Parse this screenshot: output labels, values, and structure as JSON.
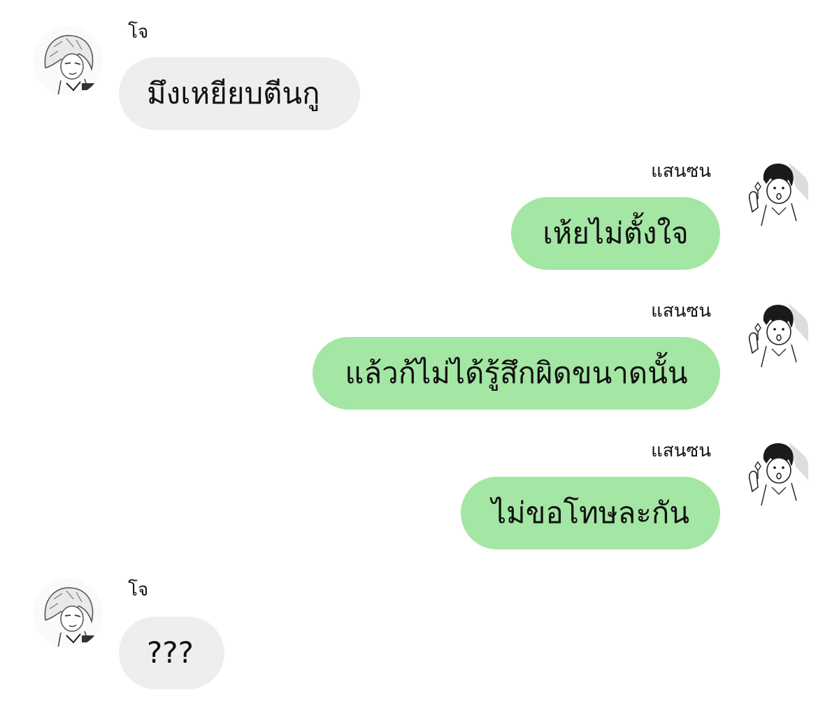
{
  "colors": {
    "background": "#ffffff",
    "incoming_bubble": "#eeeeee",
    "outgoing_bubble": "#a4e6a4",
    "text": "#111111"
  },
  "messages": [
    {
      "sender": "โจ",
      "side": "left",
      "text": "มึงเหยียบตีนกู",
      "avatar": "jo-avatar"
    },
    {
      "sender": "แสนซน",
      "side": "right",
      "text": "เห้ยไม่ตั้งใจ",
      "avatar": "saensonvatar"
    },
    {
      "sender": "แสนซน",
      "side": "right",
      "text": "แล้วก้ไม่ได้รู้สึกผิดขนาดนั้น",
      "avatar": "saenson-avatar"
    },
    {
      "sender": "แสนซน",
      "side": "right",
      "text": "ไม่ขอโทษละกัน",
      "avatar": "saenson-avatar"
    },
    {
      "sender": "โจ",
      "side": "left",
      "text": "???",
      "avatar": "jo-avatar"
    }
  ]
}
